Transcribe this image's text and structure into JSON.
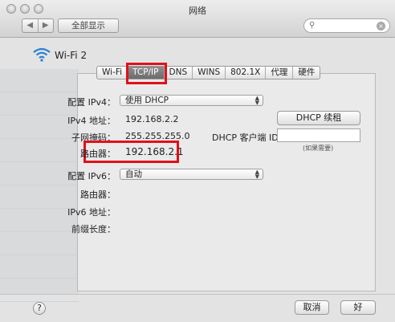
{
  "window": {
    "title": "网络"
  },
  "toolbar": {
    "back_glyph": "◀",
    "forward_glyph": "▶",
    "show_all_label": "全部显示",
    "search_placeholder": ""
  },
  "interface": {
    "name": "Wi-Fi 2",
    "icon": "wifi-icon"
  },
  "tabs": [
    {
      "label": "Wi-Fi",
      "active": false
    },
    {
      "label": "TCP/IP",
      "active": true
    },
    {
      "label": "DNS",
      "active": false
    },
    {
      "label": "WINS",
      "active": false
    },
    {
      "label": "802.1X",
      "active": false
    },
    {
      "label": "代理",
      "active": false
    },
    {
      "label": "硬件",
      "active": false
    }
  ],
  "tcpip": {
    "configure_ipv4_label": "配置 IPv4：",
    "configure_ipv4_value": "使用 DHCP",
    "ipv4_address_label": "IPv4 地址：",
    "ipv4_address_value": "192.168.2.2",
    "subnet_mask_label": "子网掩码：",
    "subnet_mask_value": "255.255.255.0",
    "router_label": "路由器：",
    "router_value": "192.168.2.1",
    "renew_dhcp_label": "DHCP 续租",
    "dhcp_client_id_label": "DHCP 客户端 ID：",
    "dhcp_client_id_value": "",
    "if_required_note": "(如果需要)",
    "configure_ipv6_label": "配置 IPv6：",
    "configure_ipv6_value": "自动",
    "ipv6_router_label": "路由器：",
    "ipv6_address_label": "IPv6 地址：",
    "prefix_length_label": "前缀长度："
  },
  "footer": {
    "help_glyph": "?",
    "cancel_label": "取消",
    "ok_label": "好"
  },
  "colors": {
    "highlight": "#e0101a",
    "active_tab": "#7a7a7a"
  }
}
